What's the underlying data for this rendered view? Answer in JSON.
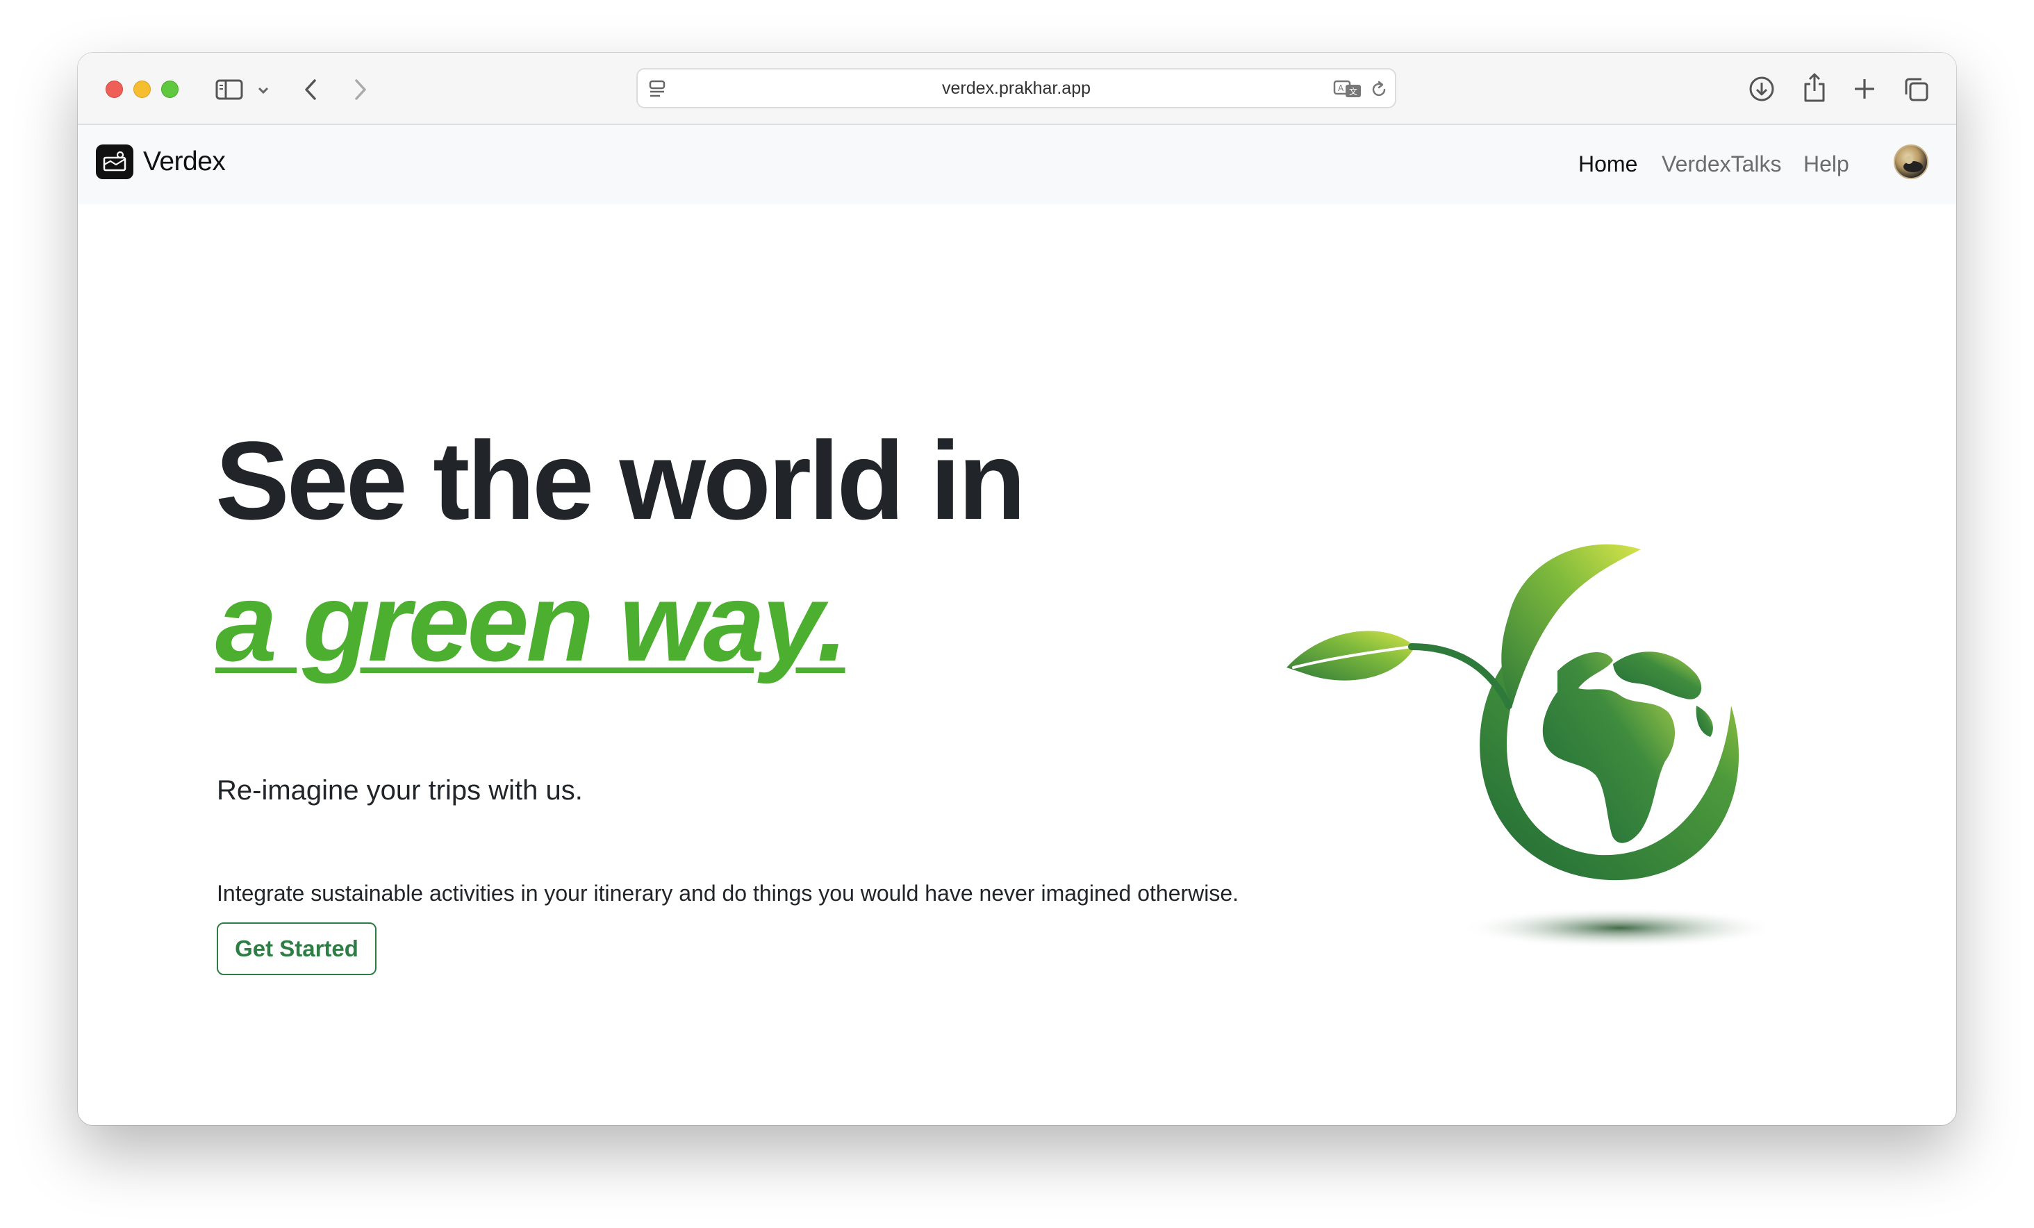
{
  "browser": {
    "url": "verdex.prakhar.app"
  },
  "navbar": {
    "brand": "Verdex",
    "links": [
      "Home",
      "VerdexTalks",
      "Help"
    ]
  },
  "hero": {
    "title_line1": "See the world in",
    "title_line2": "a green way.",
    "subtitle": "Re-imagine your trips with us.",
    "description": "Integrate sustainable activities in your itinerary and do things you would have never imagined otherwise.",
    "cta_label": "Get Started"
  },
  "colors": {
    "accent_green": "#4caf2f",
    "button_green": "#2e7d44",
    "title_dark": "#212529"
  },
  "icons": [
    "sidebar-icon",
    "chevron-down-icon",
    "back-icon",
    "forward-icon",
    "page-menu-icon",
    "translate-icon",
    "reload-icon",
    "download-icon",
    "share-icon",
    "new-tab-icon",
    "tabs-overview-icon",
    "brand-logo-icon",
    "globe-leaf-icon"
  ]
}
